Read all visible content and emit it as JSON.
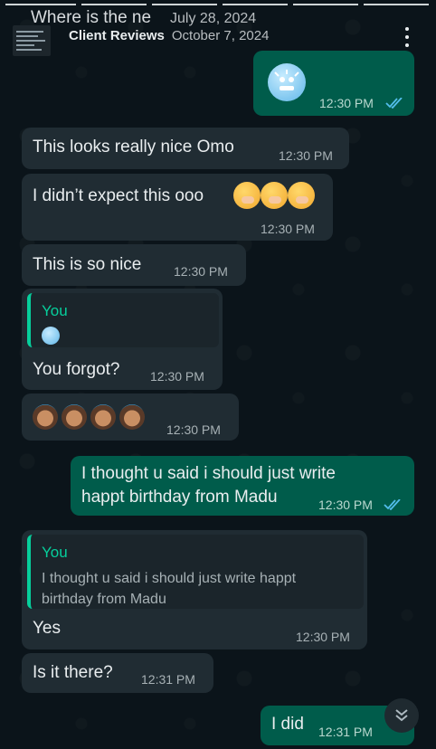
{
  "header": {
    "row1_title": "Where is the ne",
    "row1_date": "July 28, 2024",
    "row2_title": "Client Reviews",
    "row2_date": "October 7, 2024"
  },
  "messages": {
    "m1": {
      "time": "12:30 PM"
    },
    "m2": {
      "text": "This looks really nice Omo",
      "time": "12:30 PM"
    },
    "m3": {
      "text": "I didn’t expect this ooo",
      "time": "12:30 PM"
    },
    "m4": {
      "text": "This is so nice",
      "time": "12:30 PM"
    },
    "m5": {
      "quote_author": "You",
      "text": "You forgot?",
      "time": "12:30 PM"
    },
    "m6": {
      "time": "12:30 PM"
    },
    "m7": {
      "line1": "I thought u said i should just write",
      "line2": "happt birthday from Madu",
      "time": "12:30 PM"
    },
    "m8": {
      "quote_author": "You",
      "quote_line1": "I thought u said i should just write happt",
      "quote_line2": "birthday from Madu",
      "text": "Yes",
      "time": "12:30 PM"
    },
    "m9": {
      "text": "Is it there?",
      "time": "12:31 PM"
    },
    "m10": {
      "text": "I did",
      "time": "12:31 PM"
    }
  },
  "icons": {
    "frozen_face": "cold-face-emoji",
    "laugh": "face-with-hand-over-mouth-emoji",
    "woman": "woman-emoji",
    "read_ticks": "double-check-icon",
    "scroll": "double-chevron-down-icon",
    "menu": "more-vert-icon"
  },
  "colors": {
    "background": "#0b141a",
    "incoming": "#202c33",
    "outgoing": "#005c4b",
    "accent": "#06cf9c",
    "read_tick": "#53bdeb"
  }
}
